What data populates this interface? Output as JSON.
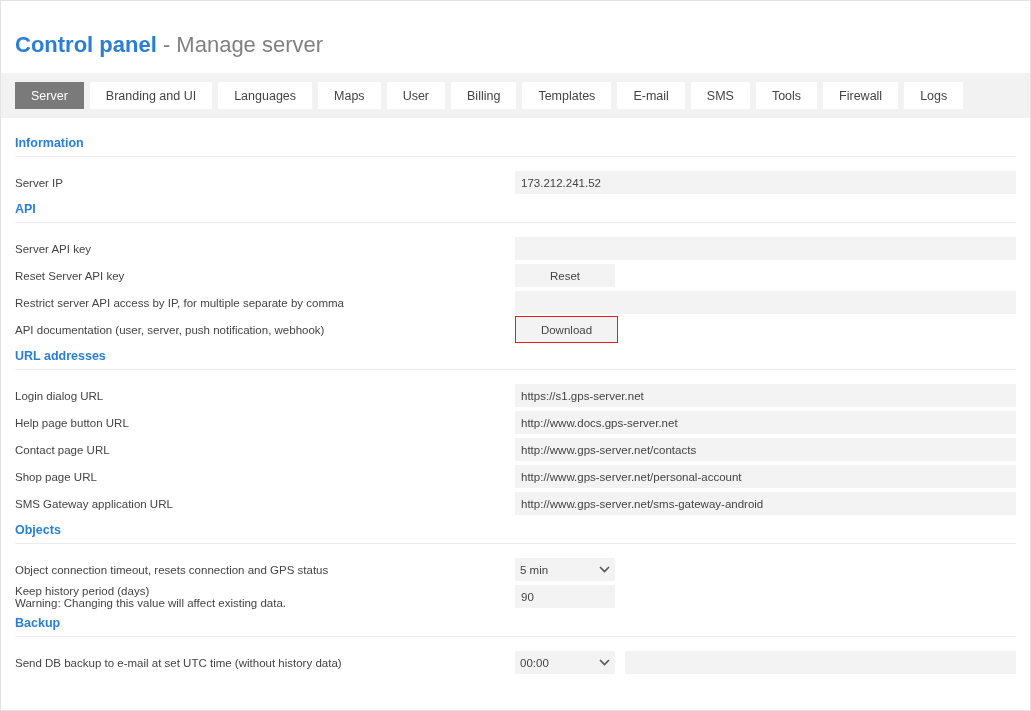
{
  "title": {
    "main": "Control panel",
    "sub": "- Manage server"
  },
  "tabs": [
    {
      "label": "Server",
      "selected": true
    },
    {
      "label": "Branding and UI",
      "selected": false
    },
    {
      "label": "Languages",
      "selected": false
    },
    {
      "label": "Maps",
      "selected": false
    },
    {
      "label": "User",
      "selected": false
    },
    {
      "label": "Billing",
      "selected": false
    },
    {
      "label": "Templates",
      "selected": false
    },
    {
      "label": "E-mail",
      "selected": false
    },
    {
      "label": "SMS",
      "selected": false
    },
    {
      "label": "Tools",
      "selected": false
    },
    {
      "label": "Firewall",
      "selected": false
    },
    {
      "label": "Logs",
      "selected": false
    }
  ],
  "sections": [
    {
      "heading": "Information",
      "rows": [
        {
          "kind": "field",
          "label": "Server IP",
          "value": "173.212.241.52"
        }
      ]
    },
    {
      "heading": "API",
      "rows": [
        {
          "kind": "field",
          "label": "Server API key"
        },
        {
          "kind": "button",
          "label": "Reset Server API key",
          "button": "Reset",
          "highlighted": false
        },
        {
          "kind": "field",
          "label": "Restrict server API access by IP, for multiple separate by comma"
        },
        {
          "kind": "button",
          "label": "API documentation (user, server, push notification, webhook)",
          "button": "Download",
          "highlighted": true
        }
      ]
    },
    {
      "heading": "URL addresses",
      "rows": [
        {
          "kind": "field",
          "label": "Login dialog URL",
          "value": "https://s1.gps-server.net"
        },
        {
          "kind": "field",
          "label": "Help page button URL",
          "value": "http://www.docs.gps-server.net"
        },
        {
          "kind": "field",
          "label": "Contact page URL",
          "value": "http://www.gps-server.net/contacts"
        },
        {
          "kind": "field",
          "label": "Shop page URL",
          "value": "http://www.gps-server.net/personal-account"
        },
        {
          "kind": "field",
          "label": "SMS Gateway application URL",
          "value": "http://www.gps-server.net/sms-gateway-android"
        }
      ]
    },
    {
      "heading": "Objects",
      "rows": [
        {
          "kind": "select",
          "label": "Object connection timeout, resets connection and GPS status",
          "value": "5 min"
        },
        {
          "kind": "short-field",
          "label": "Keep history period (days)",
          "note": "Warning: Changing this value will affect existing data.",
          "value": "90"
        }
      ]
    },
    {
      "heading": "Backup",
      "rows": [
        {
          "kind": "select-field",
          "label": "Send DB backup to e-mail at set UTC time (without history data)",
          "value": "00:00"
        }
      ]
    }
  ]
}
